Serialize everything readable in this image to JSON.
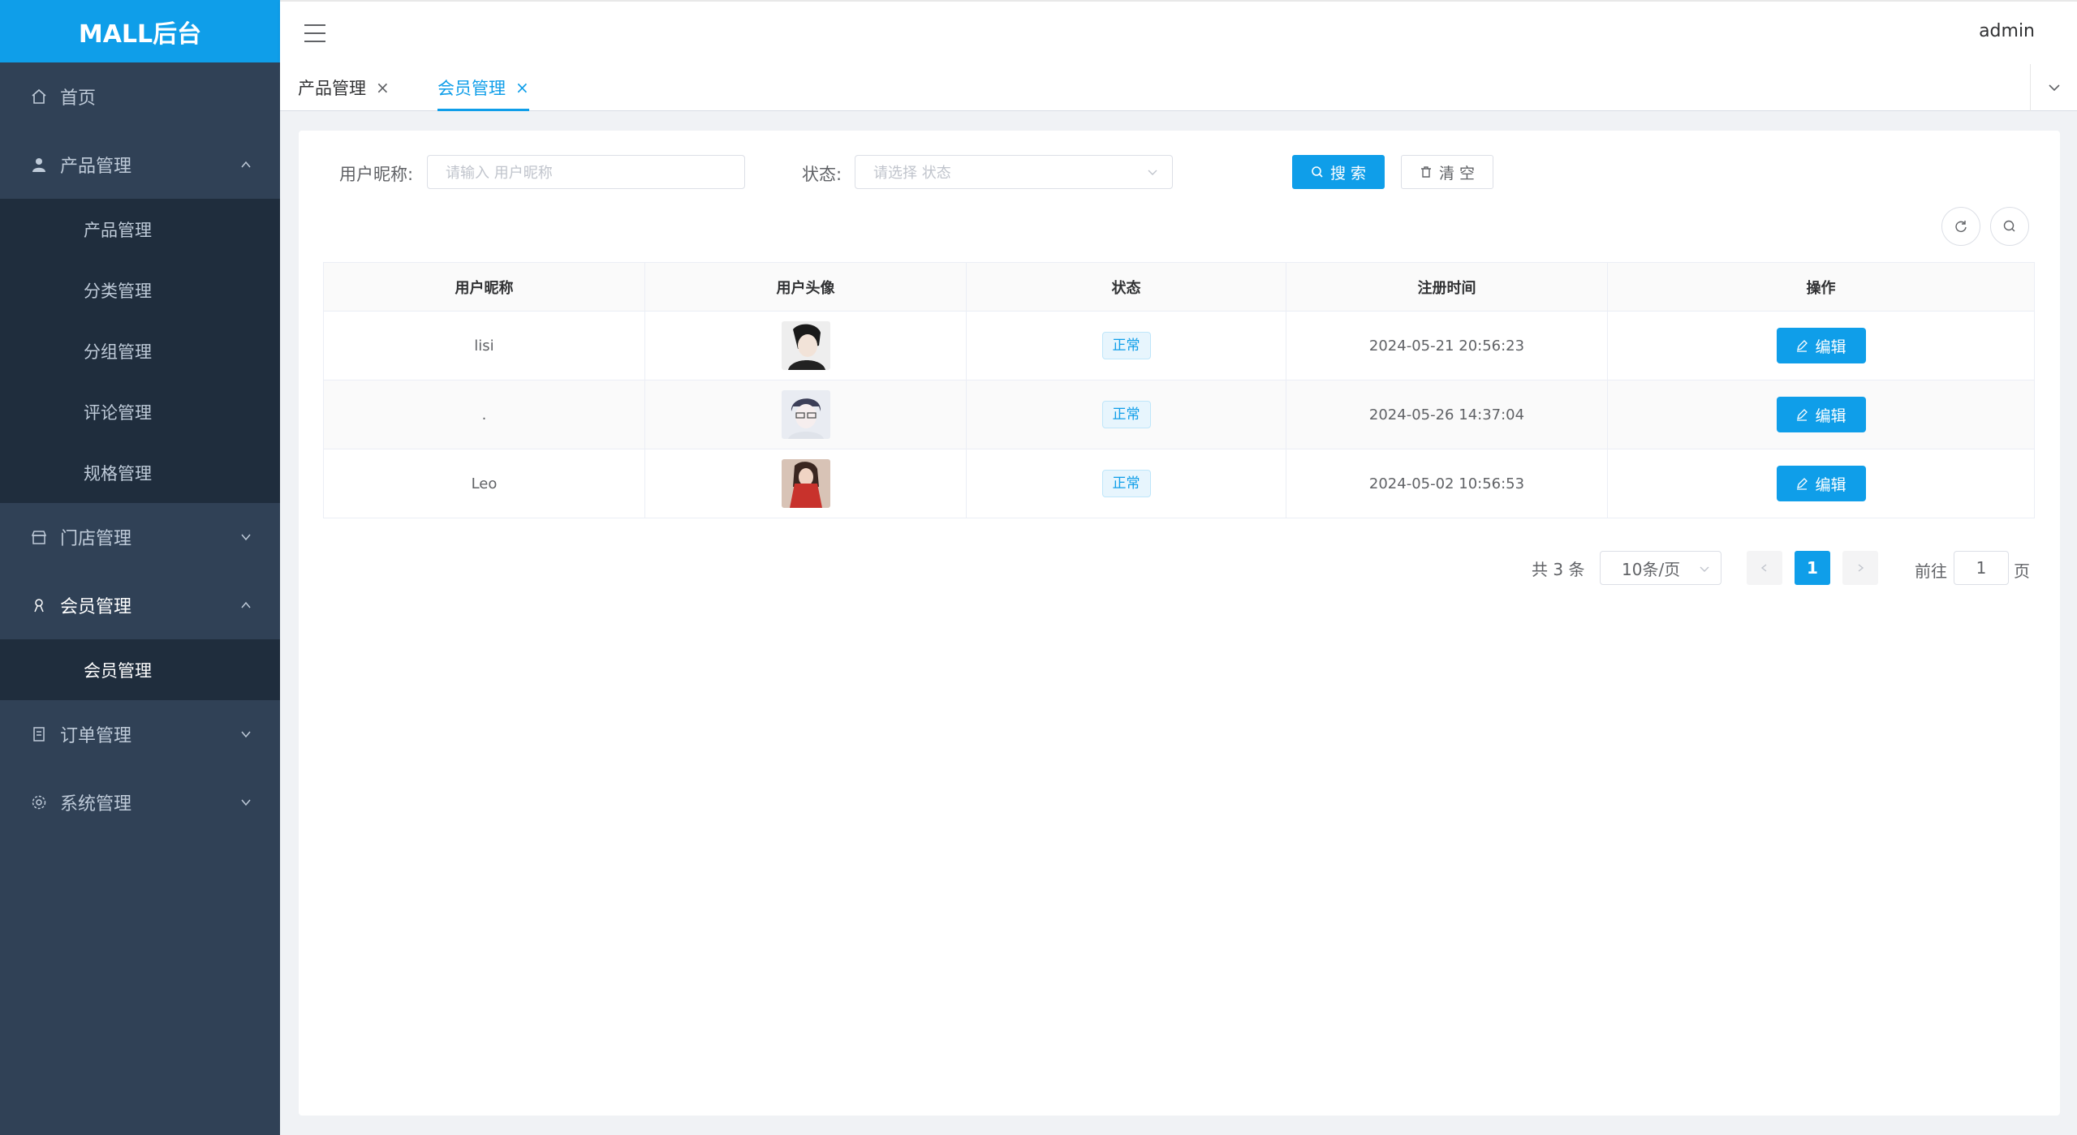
{
  "app": {
    "logo": "MALL后台",
    "user": "admin"
  },
  "sidebar": {
    "home": "首页",
    "product": {
      "label": "产品管理",
      "items": [
        "产品管理",
        "分类管理",
        "分组管理",
        "评论管理",
        "规格管理"
      ]
    },
    "store": "门店管理",
    "member": {
      "label": "会员管理",
      "items": [
        "会员管理"
      ]
    },
    "order": "订单管理",
    "system": "系统管理"
  },
  "tabs": [
    {
      "label": "产品管理",
      "close": "×"
    },
    {
      "label": "会员管理",
      "close": "×"
    }
  ],
  "filters": {
    "nickname_label": "用户昵称:",
    "nickname_placeholder": "请输入 用户昵称",
    "status_label": "状态:",
    "status_placeholder": "请选择 状态",
    "search_btn": "搜 索",
    "clear_btn": "清 空"
  },
  "table": {
    "headers": [
      "用户昵称",
      "用户头像",
      "状态",
      "注册时间",
      "操作"
    ],
    "rows": [
      {
        "nickname": "lisi",
        "status": "正常",
        "registered": "2024-05-21 20:56:23",
        "action": "编辑"
      },
      {
        "nickname": ".",
        "status": "正常",
        "registered": "2024-05-26 14:37:04",
        "action": "编辑"
      },
      {
        "nickname": "Leo",
        "status": "正常",
        "registered": "2024-05-02 10:56:53",
        "action": "编辑"
      }
    ]
  },
  "pagination": {
    "total": "共 3 条",
    "page_size": "10条/页",
    "current_page": "1",
    "goto_label": "前往",
    "goto_value": "1",
    "page_unit": "页"
  },
  "colors": {
    "primary": "#0f9ee9",
    "sidebar": "#304156",
    "sidebar_sub": "#1f2d3d"
  }
}
